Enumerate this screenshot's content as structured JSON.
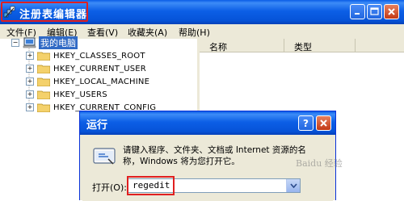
{
  "window": {
    "title": "注册表编辑器"
  },
  "menu": [
    "文件(F)",
    "编辑(E)",
    "查看(V)",
    "收藏夹(A)",
    "帮助(H)"
  ],
  "tree": {
    "root": "我的电脑",
    "keys": [
      "HKEY_CLASSES_ROOT",
      "HKEY_CURRENT_USER",
      "HKEY_LOCAL_MACHINE",
      "HKEY_USERS",
      "HKEY_CURRENT_CONFIG"
    ]
  },
  "columns": {
    "name": "名称",
    "type": "类型"
  },
  "run_dialog": {
    "title": "运行",
    "description_line1": "请键入程序、文件夹、文档或 Internet 资源的名",
    "description_line2": "称，Windows 将为您打开它。",
    "open_label": "打开(O):",
    "input_value": "regedit"
  },
  "watermark": "Baidu 经验",
  "colors": {
    "title_bar": "#0a5ce6",
    "highlight_box": "#e02020",
    "selection": "#316ac5",
    "chrome": "#ece9d8"
  }
}
